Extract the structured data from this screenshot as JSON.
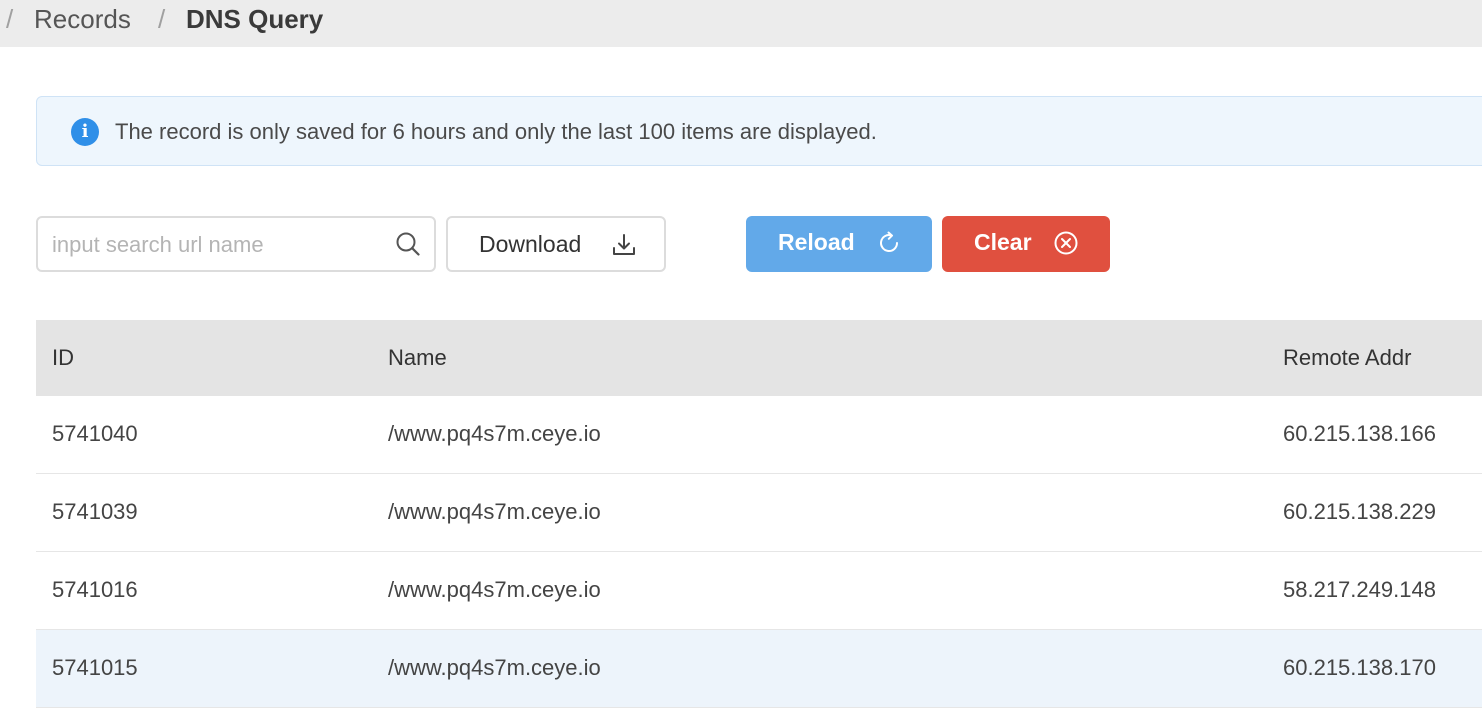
{
  "breadcrumb": {
    "separator": "/",
    "items": [
      "Records",
      "DNS Query"
    ]
  },
  "alert": {
    "icon": "info-icon",
    "icon_glyph": "i",
    "text": "The record is only saved for 6 hours and only the last 100 items are displayed."
  },
  "toolbar": {
    "search_placeholder": "input search url name",
    "search_value": "",
    "download_label": "Download",
    "reload_label": "Reload",
    "clear_label": "Clear"
  },
  "table": {
    "columns": [
      "ID",
      "Name",
      "Remote Addr"
    ],
    "rows": [
      {
        "id": "5741040",
        "name": "/www.pq4s7m.ceye.io",
        "remote_addr": "60.215.138.166"
      },
      {
        "id": "5741039",
        "name": "/www.pq4s7m.ceye.io",
        "remote_addr": "60.215.138.229"
      },
      {
        "id": "5741016",
        "name": "/www.pq4s7m.ceye.io",
        "remote_addr": "58.217.249.148"
      },
      {
        "id": "5741015",
        "name": "/www.pq4s7m.ceye.io",
        "remote_addr": "60.215.138.170"
      }
    ]
  },
  "colors": {
    "reload": "#62a9e9",
    "clear": "#e0503f",
    "info": "#2f8fe8",
    "row_highlight": "#edf4fb"
  }
}
